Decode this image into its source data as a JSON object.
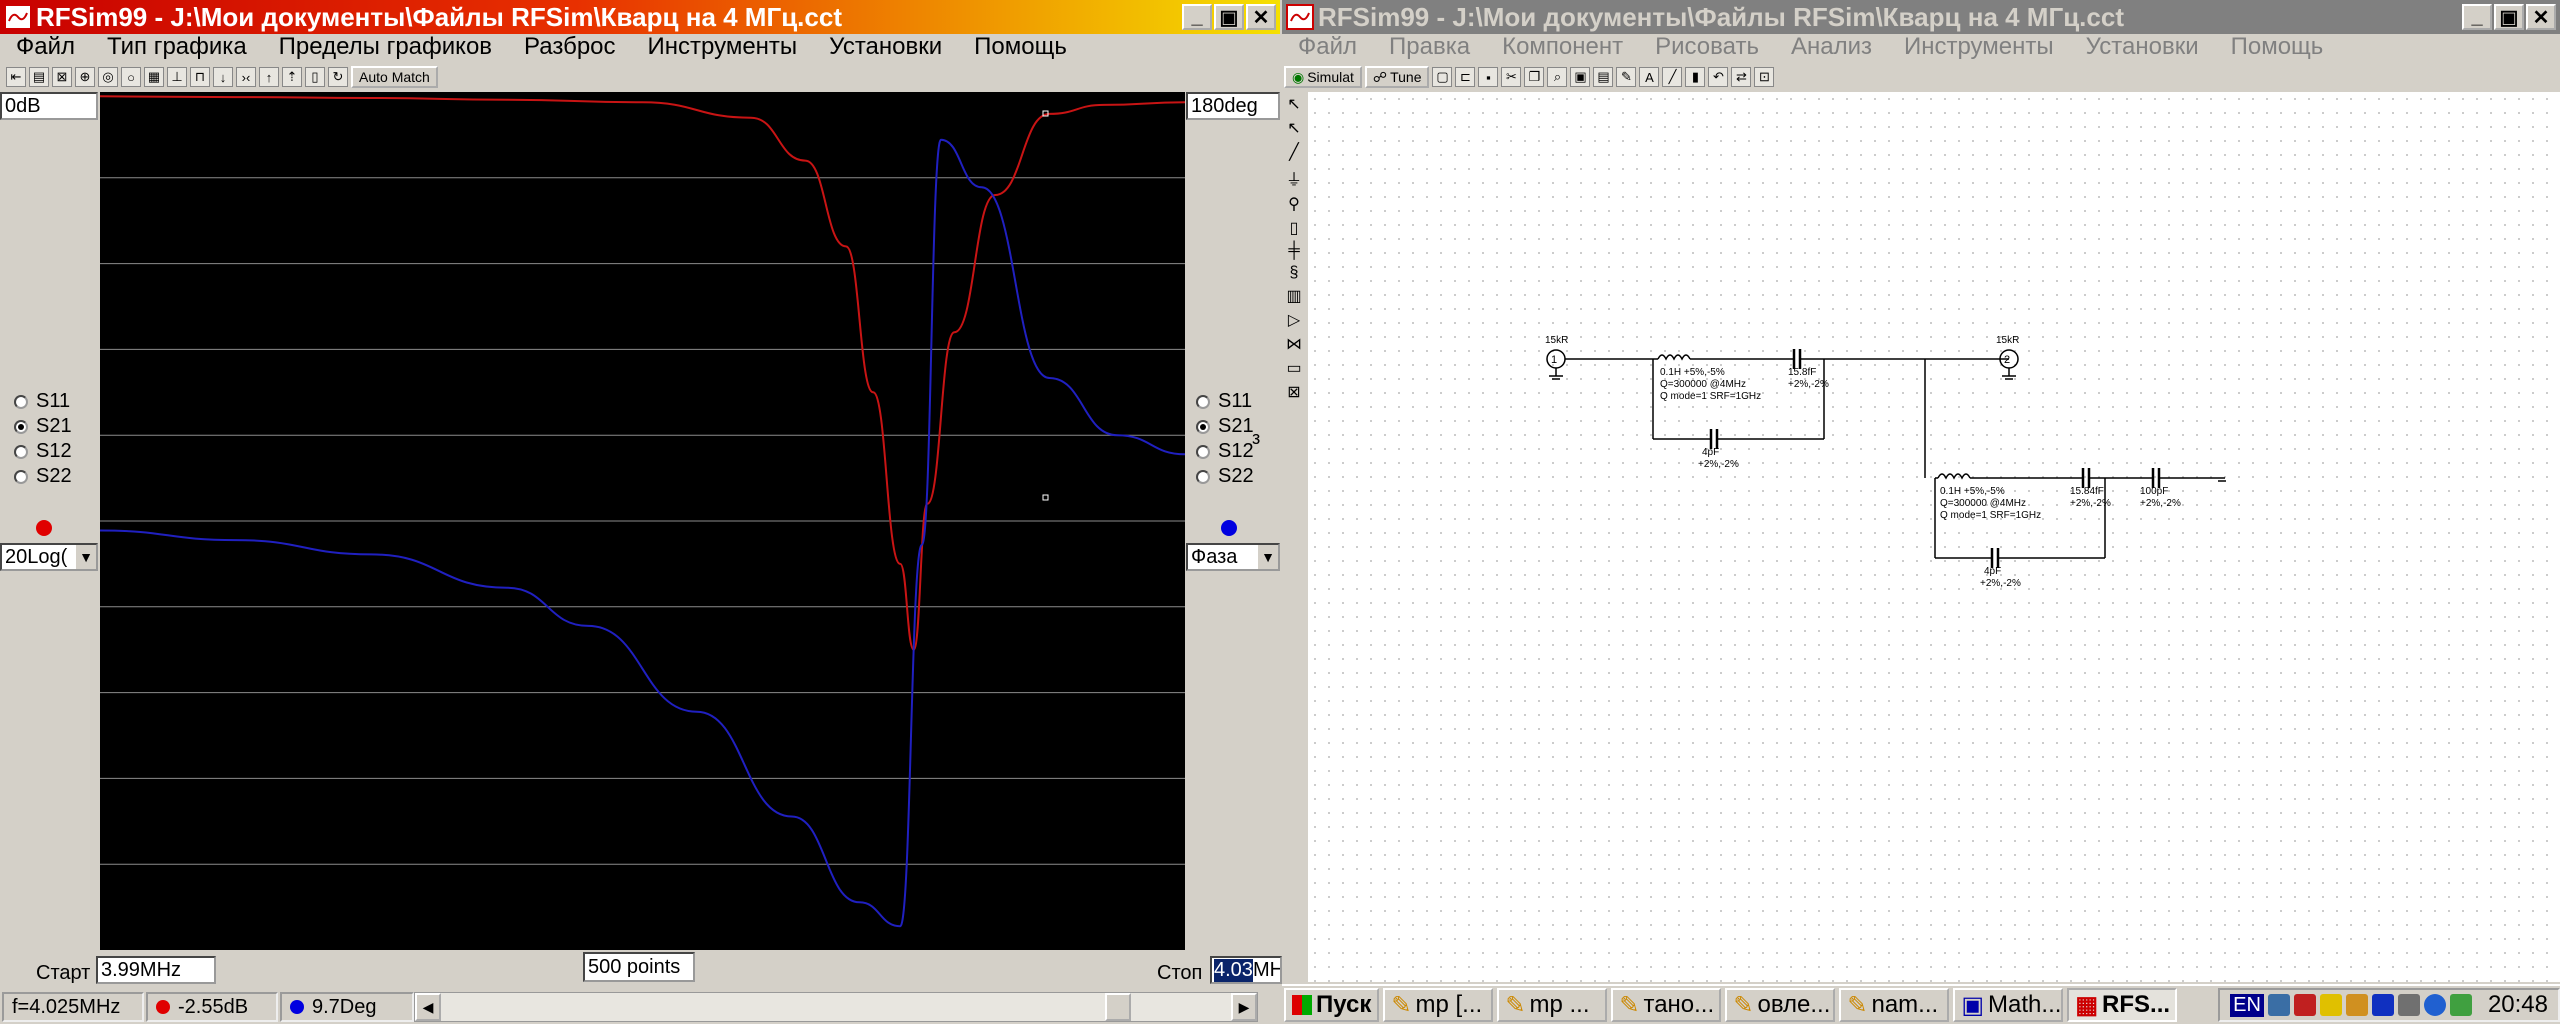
{
  "left_window": {
    "title": "RFSim99 - J:\\Мои документы\\Файлы RFSim\\Кварц на 4 МГц.cct",
    "menu": [
      "Файл",
      "Тип графика",
      "Пределы графиков",
      "Разброс",
      "Инструменты",
      "Установки",
      "Помощь"
    ],
    "toolbar_button": "Auto Match",
    "left_axis_top": "0dB",
    "right_axis_top": "180deg",
    "left_radios": [
      {
        "label": "S11",
        "checked": false
      },
      {
        "label": "S21",
        "checked": true
      },
      {
        "label": "S12",
        "checked": false
      },
      {
        "label": "S22",
        "checked": false
      }
    ],
    "right_radios": [
      {
        "label": "S11",
        "checked": false
      },
      {
        "label": "S21",
        "checked": true
      },
      {
        "label": "S12",
        "checked": false
      },
      {
        "label": "S22",
        "checked": false
      }
    ],
    "left_select": "20Log(",
    "right_select": "Фаза",
    "right_stray_char": "з",
    "start_label": "Старт",
    "start_value": "3.99MHz",
    "points_value": "500 points",
    "stop_label": "Стоп",
    "stop_value_selected": "4.03",
    "stop_value_rest": "MH",
    "status_freq": "f=4.025MHz",
    "status_mag": "-2.55dB",
    "status_phase": "9.7Deg",
    "colors": {
      "magnitude": "#c81414",
      "phase": "#2020c0",
      "red_marker": "#e00000",
      "blue_marker": "#0000e0",
      "plot_bg": "#000000",
      "grid": "#8c8c8c"
    },
    "chart_data": {
      "type": "line",
      "title": "",
      "xlabel": "",
      "ylabel": "",
      "x_unit": "MHz",
      "x_range": [
        3.99,
        4.03
      ],
      "series": [
        {
          "color": "#c81414",
          "axis": "left",
          "x": [
            3.99,
            3.995,
            4.0,
            4.005,
            4.01,
            4.014,
            4.016,
            4.0175,
            4.0185,
            4.0195,
            4.02,
            4.0205,
            4.0215,
            4.023,
            4.025,
            4.027,
            4.03
          ],
          "y": [
            0.5,
            0.6,
            0.7,
            0.9,
            1.2,
            3,
            8,
            18,
            35,
            55,
            65,
            48,
            28,
            12,
            2.55,
            1.5,
            1.2
          ]
        },
        {
          "color": "#2020c0",
          "axis": "right",
          "x": [
            3.99,
            3.995,
            4.0,
            4.005,
            4.008,
            4.012,
            4.0155,
            4.018,
            4.0195,
            4.0203,
            4.021,
            4.0225,
            4.025,
            4.0275,
            4.03
          ],
          "y": [
            -2,
            -4,
            -7,
            -14,
            -22,
            -40,
            -62,
            -80,
            -85,
            -5,
            80,
            70,
            30,
            18,
            14
          ]
        }
      ]
    }
  },
  "right_window": {
    "title": "RFSim99 - J:\\Мои документы\\Файлы RFSim\\Кварц на 4 МГц.cct",
    "menu": [
      "Файл",
      "Правка",
      "Компонент",
      "Рисовать",
      "Анализ",
      "Инструменты",
      "Установки",
      "Помощь"
    ],
    "toolbar_simulate": "Simulat",
    "toolbar_tune": "Tune",
    "schematic_labels": {
      "port1": "1",
      "port2": "2",
      "port1_imp": "15kR",
      "port2_imp": "15kR",
      "l1_a": "0.1H  +5%,-5%",
      "l1_b": "Q=300000 @4MHz",
      "l1_c": "Q mode=1 SRF=1GHz",
      "c1_val": "15.8fF",
      "c1_tol": "+2%,-2%",
      "c2_val": "4pF",
      "c2_tol": "+2%,-2%",
      "l2_a": "0.1H  +5%,-5%",
      "l2_b": "Q=300000 @4MHz",
      "l2_c": "Q mode=1 SRF=1GHz",
      "c3_val": "15.84fF",
      "c3_tol": "+2%,-2%",
      "c4_val": "100pF",
      "c4_tol": "+2%,-2%",
      "c5_val": "4pF",
      "c5_tol": "+2%,-2%"
    }
  },
  "taskbar": {
    "start": "Пуск",
    "tasks": [
      "mp [...",
      "mp ...",
      "тано...",
      "овле...",
      "nam...",
      "Math...",
      "RFS..."
    ],
    "lang": "EN",
    "clock": "20:48"
  }
}
